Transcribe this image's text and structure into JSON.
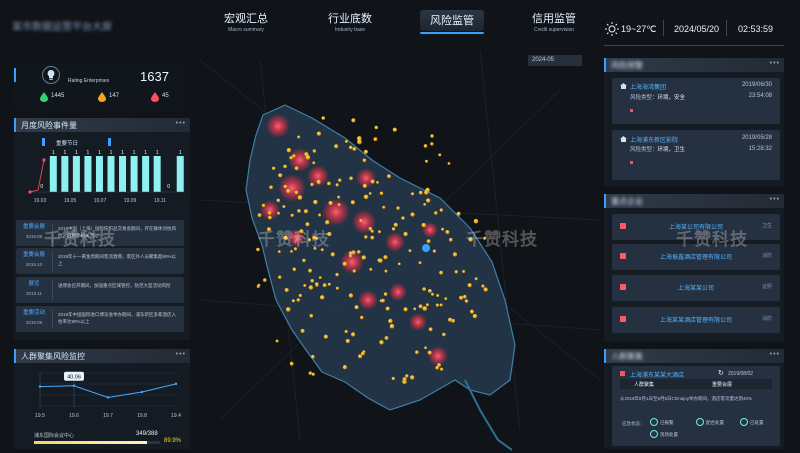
{
  "app": {
    "title": "某市数据运营平台大屏"
  },
  "nav": [
    {
      "zh": "宏观汇总",
      "en": "Macro summary"
    },
    {
      "zh": "行业底数",
      "en": "Industry base"
    },
    {
      "zh": "风险监管",
      "en": ""
    },
    {
      "zh": "信用监管",
      "en": "Credit supervision"
    }
  ],
  "header": {
    "weather": "19~27℃",
    "date": "2024/05/20",
    "time": "02:53:59"
  },
  "month_filter": "2024-05",
  "kpis": {
    "label": "Rating Enterprises",
    "total": "1637",
    "green": "1445",
    "amber": "147",
    "red": "45"
  },
  "monthly_panel": {
    "title": "月度风险事件量",
    "legend": "重要节日",
    "x_labels": [
      "19.03",
      "19.05",
      "19.07",
      "19.09",
      "19.11"
    ],
    "values": [
      0,
      1,
      1,
      1,
      1,
      1,
      1,
      1,
      1,
      1,
      1,
      0,
      1
    ],
    "zero_a": "0",
    "zero_b": "0",
    "one": "1"
  },
  "events": [
    {
      "label": "重要会展",
      "date": "2019.08",
      "text": "2019中国（上海）国际纺织品交易会期间，存在群体对抗风险，已暂停相关活动"
    },
    {
      "label": "重要会展",
      "date": "2019.10",
      "text": "2019年十一黄金周期间客流激增，景区外人员聚集超90%以上"
    },
    {
      "label": "展览",
      "date": "2019.11",
      "text": "进博会召开期间，加强重点区域管控，防范大型活动风险"
    },
    {
      "label": "重要活动",
      "date": "2019.06",
      "text": "2019年中国国际进口博览会举办期间，浦东新区多家酒店入住率达90%以上"
    }
  ],
  "crowd_panel": {
    "title": "人群聚集风险监控",
    "tooltip": "40.06",
    "x_labels": [
      "19.5",
      "19.6",
      "19.7",
      "19.8",
      "19.4"
    ],
    "values": [
      40,
      40.06,
      39.2,
      39.6,
      40.2
    ],
    "footer_label": "浦东国际会议中心",
    "footer_value": "349",
    "footer_total": "/388",
    "footer_pct": "89.9%",
    "pct_value": 89.9
  },
  "alerts": [
    {
      "name": "上海海湾集团",
      "date": "2019/06/30",
      "time": "23:54:08",
      "type_label": "风险类型：",
      "type": "环境，安全"
    },
    {
      "name": "上海浦东新区影院",
      "date": "2019/05/28",
      "time": "15:28:32",
      "type_label": "风险类型：",
      "type": "环境，卫生"
    }
  ],
  "companies": [
    {
      "name": "上海某公司有限公司",
      "tag": "卫生"
    },
    {
      "name": "上海振鑫酒店管理有限公司",
      "tag": "消防"
    },
    {
      "name": "上海某某公司",
      "tag": "证照"
    },
    {
      "name": "上海某某酒店管理有限公司",
      "tag": "消防"
    }
  ],
  "hotel_card": {
    "name": "上海浦东某某大酒店",
    "date": "2019/08/02",
    "row_a": "人群聚集",
    "row_b": "重要会展",
    "desc": "从2019年8月1日至8月5日Chinajoy举办期间，酒店客流量达到40%",
    "tags_label": "应急状态：",
    "tags": [
      "已报警",
      "配合处置",
      "现场处置",
      "已处置"
    ]
  },
  "watermark": "千赞科技",
  "colors": {
    "accent": "#38a3ff",
    "bar": "#8ff0f0",
    "danger": "#ff4f5f",
    "dot": "#f7c100"
  }
}
